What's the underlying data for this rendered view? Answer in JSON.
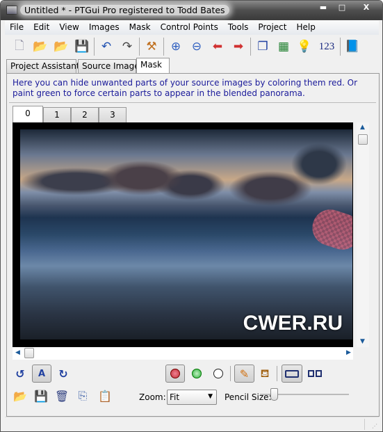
{
  "window": {
    "title": "Untitled * - PTGui Pro registered to Todd Bates",
    "minimize": "▬",
    "maximize": "□",
    "close": "X"
  },
  "menu": [
    "File",
    "Edit",
    "View",
    "Images",
    "Mask",
    "Control Points",
    "Tools",
    "Project",
    "Help"
  ],
  "toolbar": {
    "numbers_label": "123"
  },
  "tabs": [
    "Project Assistant",
    "Source Images",
    "Mask"
  ],
  "active_tab": "Mask",
  "mask": {
    "help_text": "Here you can hide unwanted parts of your source images by coloring them red. Or paint green to force certain parts to appear in the blended panorama.",
    "image_tabs": [
      "0",
      "1",
      "2",
      "3"
    ],
    "active_image_tab": "0",
    "watermark": "CWER.RU",
    "auto_label": "A",
    "zoom_label": "Zoom:",
    "zoom_value": "Fit",
    "pencil_size_label": "Pencil Size:",
    "pencil_size_fraction": 0.1,
    "selected_color": "red",
    "colors": {
      "red": "#c0303a",
      "green": "#30b040"
    }
  }
}
